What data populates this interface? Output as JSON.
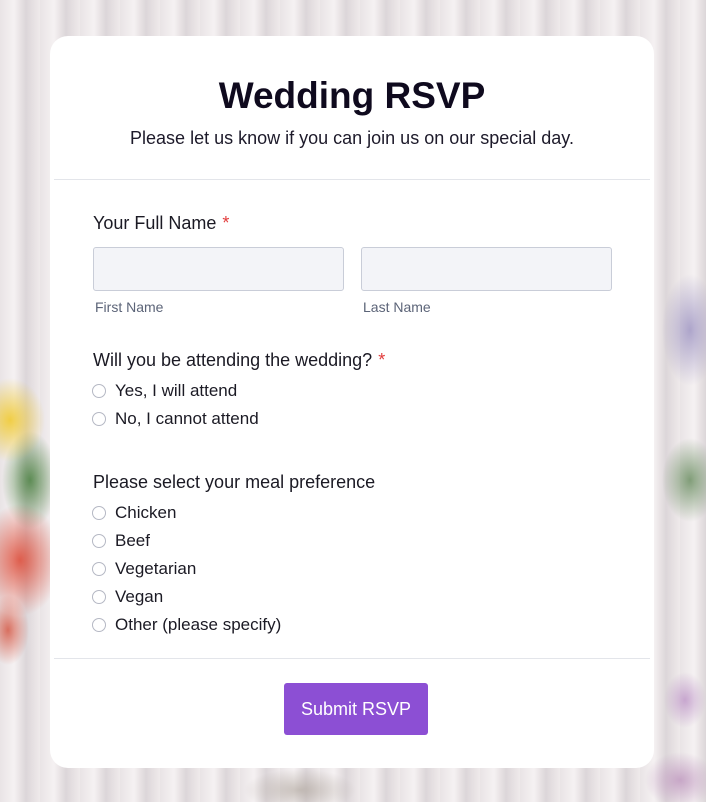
{
  "form": {
    "title": "Wedding RSVP",
    "subtitle": "Please let us know if you can join us on our special day."
  },
  "name_question": {
    "label": "Your Full Name",
    "required_mark": "*",
    "first_label": "First Name",
    "last_label": "Last Name",
    "first_value": "",
    "last_value": ""
  },
  "attendance_question": {
    "label": "Will you be attending the wedding?",
    "required_mark": "*",
    "options": [
      "Yes, I will attend",
      "No, I cannot attend"
    ]
  },
  "meal_question": {
    "label": "Please select your meal preference",
    "options": [
      "Chicken",
      "Beef",
      "Vegetarian",
      "Vegan",
      "Other (please specify)"
    ]
  },
  "submit_label": "Submit RSVP",
  "colors": {
    "accent": "#8c4fd4",
    "required": "#e23b3b",
    "input_bg": "#f3f4f8"
  }
}
